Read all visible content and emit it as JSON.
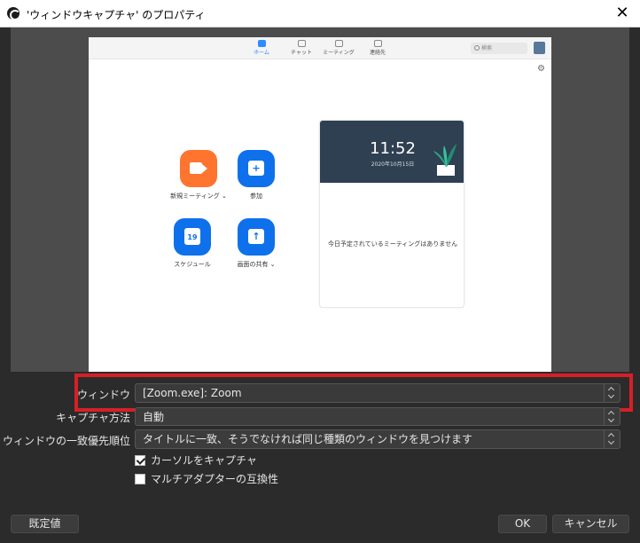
{
  "window": {
    "title": "'ウィンドウキャプチャ' のプロパティ",
    "close_glyph": "✕"
  },
  "zoom": {
    "tabs": [
      {
        "label": "ホーム",
        "active": true
      },
      {
        "label": "チャット",
        "active": false
      },
      {
        "label": "ミーティング",
        "active": false
      },
      {
        "label": "連絡先",
        "active": false
      }
    ],
    "search_placeholder": "検索",
    "gear_glyph": "⚙",
    "actions": [
      {
        "label": "新規ミーティング ⌄",
        "icon": "video-camera-icon"
      },
      {
        "label": "参加",
        "icon": "plus-icon",
        "glyph": "+"
      },
      {
        "label": "スケジュール",
        "icon": "calendar-icon",
        "glyph": "19"
      },
      {
        "label": "画面の共有 ⌄",
        "icon": "share-up-arrow-icon",
        "glyph": "↑"
      }
    ],
    "card": {
      "time": "11:52",
      "date": "2020年10月15日",
      "no_meetings": "今日予定されているミーティングはありません"
    },
    "colors": {
      "accent_blue": "#0e71eb",
      "accent_orange": "#ff742e",
      "banner": "#2f4052"
    }
  },
  "properties": {
    "window_label": "ウィンドウ",
    "window_value": "[Zoom.exe]: Zoom",
    "capture_method_label": "キャプチャ方法",
    "capture_method_value": "自動",
    "match_priority_label": "ウィンドウの一致優先順位",
    "match_priority_value": "タイトルに一致、そうでなければ同じ種類のウィンドウを見つけます",
    "capture_cursor_label": "カーソルをキャプチャ",
    "capture_cursor_checked": true,
    "multi_adapter_label": "マルチアダプターの互換性",
    "multi_adapter_checked": false,
    "highlight_color": "#d62026"
  },
  "buttons": {
    "defaults": "既定値",
    "ok": "OK",
    "cancel": "キャンセル"
  }
}
